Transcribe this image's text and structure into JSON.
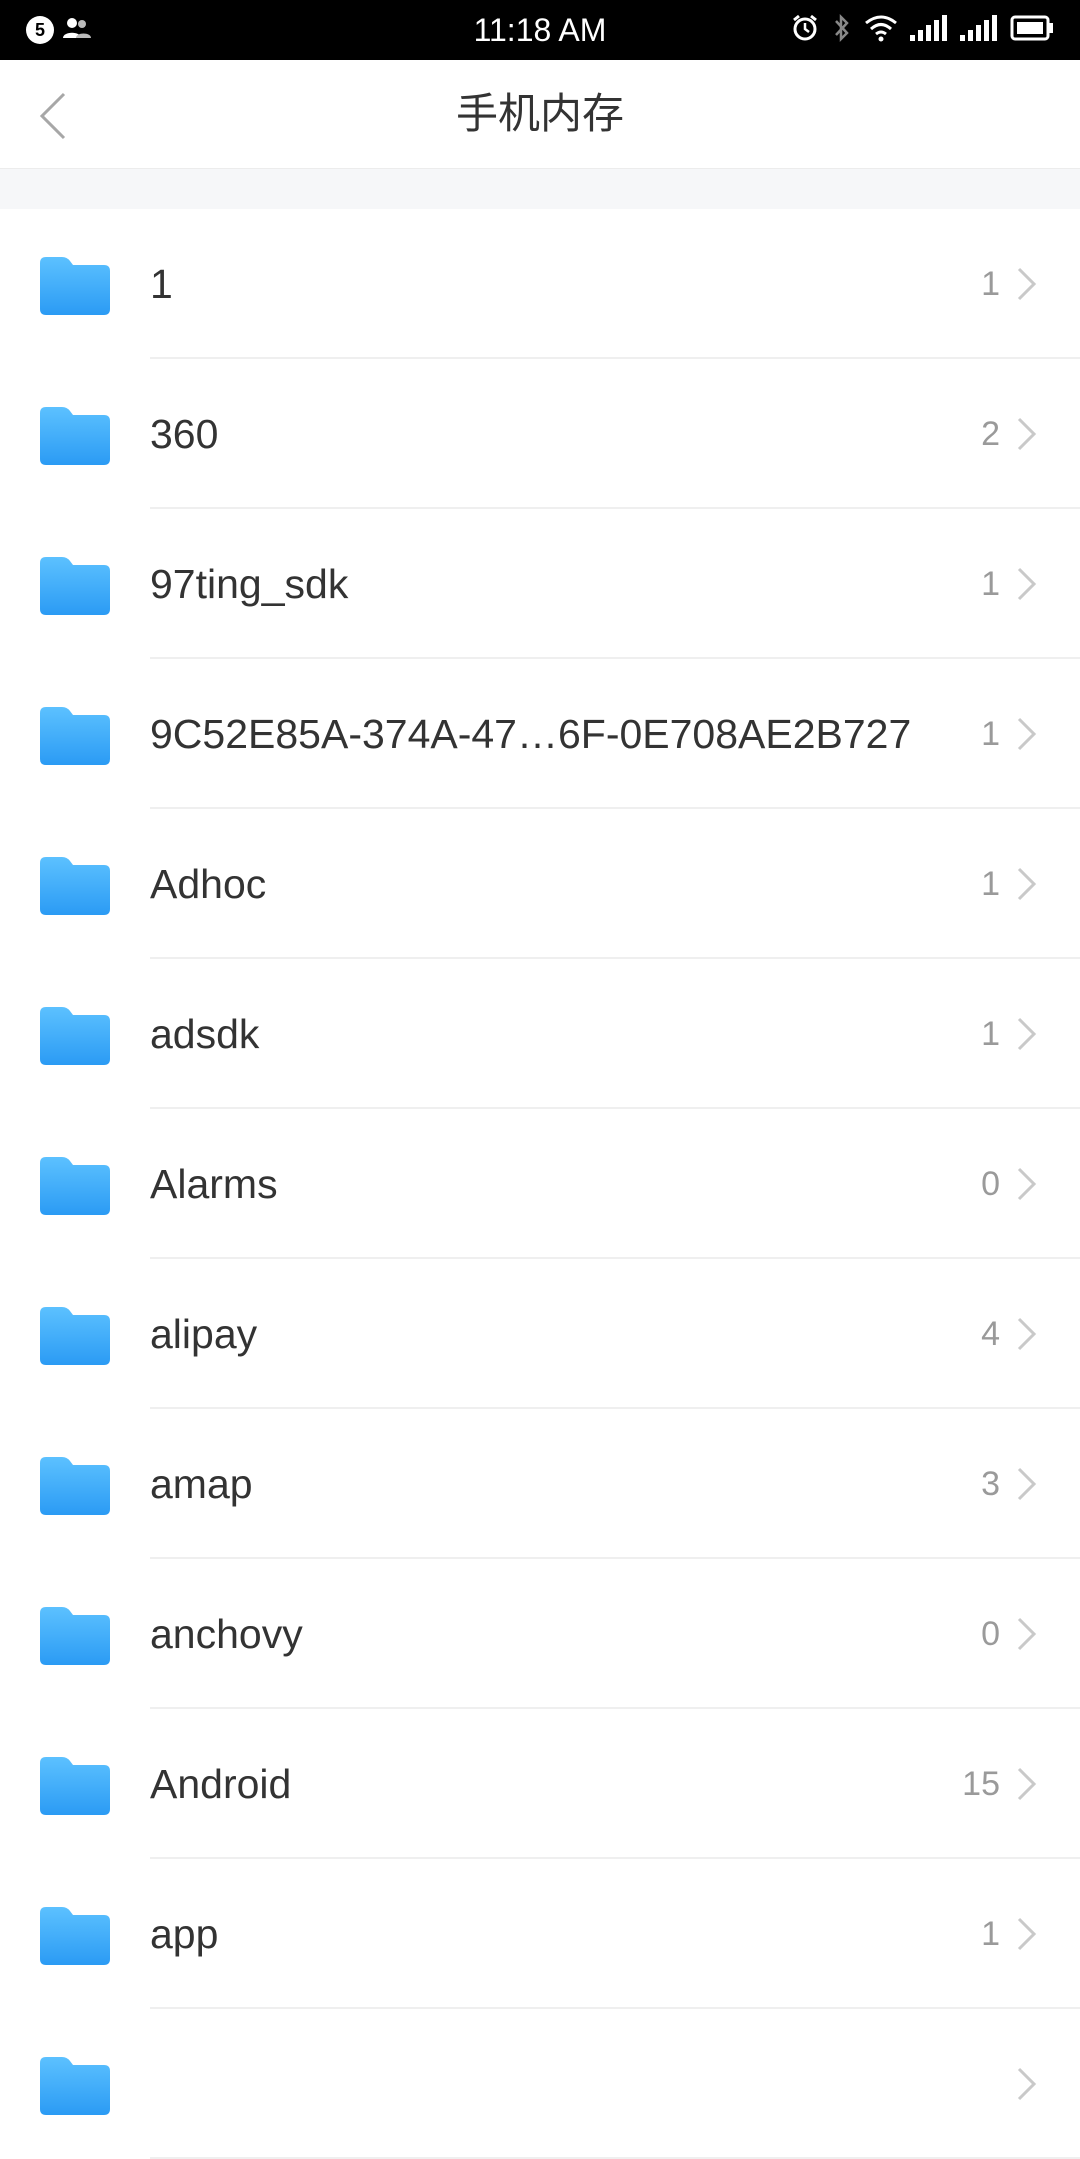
{
  "status_bar": {
    "notification_count": "5",
    "time": "11:18 AM"
  },
  "header": {
    "title": "手机内存"
  },
  "colors": {
    "folder_top": "#5cc1ff",
    "folder_bottom": "#2b9bf4",
    "count": "#9a9a9a",
    "chevron": "#c9c9c9"
  },
  "folders": [
    {
      "name": "1",
      "count": "1"
    },
    {
      "name": "360",
      "count": "2"
    },
    {
      "name": "97ting_sdk",
      "count": "1"
    },
    {
      "name": "9C52E85A-374A-47…6F-0E708AE2B727",
      "count": "1"
    },
    {
      "name": "Adhoc",
      "count": "1"
    },
    {
      "name": "adsdk",
      "count": "1"
    },
    {
      "name": "Alarms",
      "count": "0"
    },
    {
      "name": "alipay",
      "count": "4"
    },
    {
      "name": "amap",
      "count": "3"
    },
    {
      "name": "anchovy",
      "count": "0"
    },
    {
      "name": "Android",
      "count": "15"
    },
    {
      "name": "app",
      "count": "1"
    },
    {
      "name": "",
      "count": ""
    }
  ]
}
